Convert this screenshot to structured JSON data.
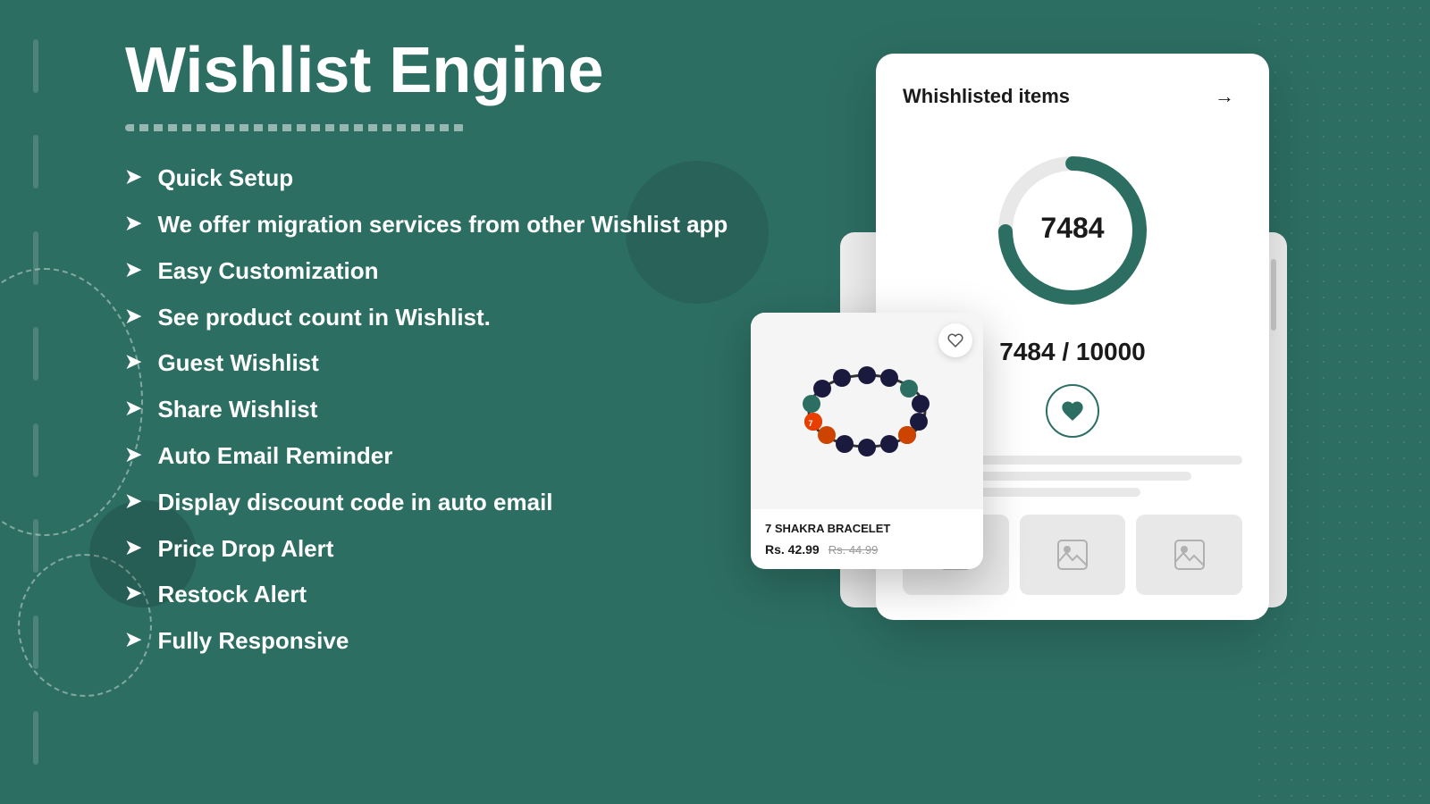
{
  "page": {
    "background_color": "#2d6e63",
    "title": "Wishlist Engine"
  },
  "header": {
    "title": "Wishlist Engine"
  },
  "features": {
    "list": [
      {
        "id": "quick-setup",
        "text": "Quick Setup"
      },
      {
        "id": "migration",
        "text": "We offer migration services from other Wishlist app"
      },
      {
        "id": "customization",
        "text": "Easy Customization"
      },
      {
        "id": "product-count",
        "text": "See product count in Wishlist."
      },
      {
        "id": "guest-wishlist",
        "text": "Guest Wishlist"
      },
      {
        "id": "share-wishlist",
        "text": "Share Wishlist"
      },
      {
        "id": "auto-email",
        "text": "Auto Email Reminder"
      },
      {
        "id": "discount-code",
        "text": "Display discount code in auto email"
      },
      {
        "id": "price-drop",
        "text": "Price Drop Alert"
      },
      {
        "id": "restock",
        "text": "Restock Alert"
      },
      {
        "id": "responsive",
        "text": "Fully Responsive"
      }
    ],
    "arrow_symbol": "➤"
  },
  "wishlist_card": {
    "title": "Whishlisted items",
    "arrow": "→",
    "count": "7484",
    "count_display": "7484 / 10000",
    "donut": {
      "value": 7484,
      "max": 10000,
      "color": "#2d6e63",
      "track_color": "#e8e8e8"
    }
  },
  "product_card": {
    "name": "7 SHAKRA BRACELET",
    "price_current": "Rs. 42.99",
    "price_original": "Rs. 44.99"
  },
  "icons": {
    "heart": "♥",
    "arrow_right": "→",
    "image_placeholder": "🖼"
  }
}
